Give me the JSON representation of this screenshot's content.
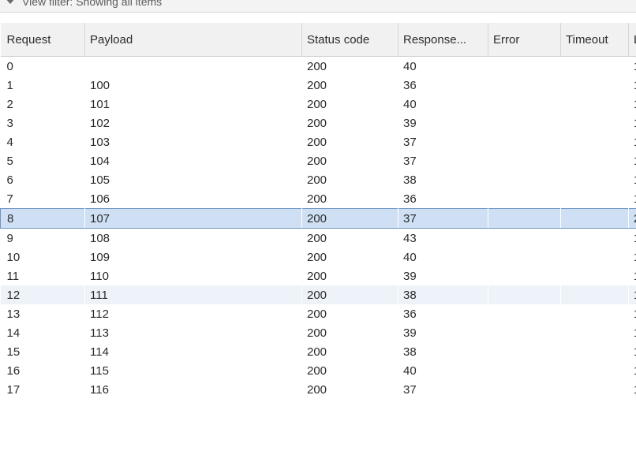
{
  "filter": {
    "label": "View filter: Showing all items"
  },
  "table": {
    "columns": [
      "Request",
      "Payload",
      "Status code",
      "Response...",
      "Error",
      "Timeout",
      "L"
    ],
    "rows": [
      {
        "request": "0",
        "payload": "",
        "status": "200",
        "response": "40",
        "error": "",
        "timeout": "",
        "length": "1"
      },
      {
        "request": "1",
        "payload": "100",
        "status": "200",
        "response": "36",
        "error": "",
        "timeout": "",
        "length": "1"
      },
      {
        "request": "2",
        "payload": "101",
        "status": "200",
        "response": "40",
        "error": "",
        "timeout": "",
        "length": "1"
      },
      {
        "request": "3",
        "payload": "102",
        "status": "200",
        "response": "39",
        "error": "",
        "timeout": "",
        "length": "1"
      },
      {
        "request": "4",
        "payload": "103",
        "status": "200",
        "response": "37",
        "error": "",
        "timeout": "",
        "length": "1"
      },
      {
        "request": "5",
        "payload": "104",
        "status": "200",
        "response": "37",
        "error": "",
        "timeout": "",
        "length": "1"
      },
      {
        "request": "6",
        "payload": "105",
        "status": "200",
        "response": "38",
        "error": "",
        "timeout": "",
        "length": "1"
      },
      {
        "request": "7",
        "payload": "106",
        "status": "200",
        "response": "36",
        "error": "",
        "timeout": "",
        "length": "1"
      },
      {
        "request": "8",
        "payload": "107",
        "status": "200",
        "response": "37",
        "error": "",
        "timeout": "",
        "length": "2"
      },
      {
        "request": "9",
        "payload": "108",
        "status": "200",
        "response": "43",
        "error": "",
        "timeout": "",
        "length": "1"
      },
      {
        "request": "10",
        "payload": "109",
        "status": "200",
        "response": "40",
        "error": "",
        "timeout": "",
        "length": "1"
      },
      {
        "request": "11",
        "payload": "110",
        "status": "200",
        "response": "39",
        "error": "",
        "timeout": "",
        "length": "1"
      },
      {
        "request": "12",
        "payload": "111",
        "status": "200",
        "response": "38",
        "error": "",
        "timeout": "",
        "length": "1"
      },
      {
        "request": "13",
        "payload": "112",
        "status": "200",
        "response": "36",
        "error": "",
        "timeout": "",
        "length": "1"
      },
      {
        "request": "14",
        "payload": "113",
        "status": "200",
        "response": "39",
        "error": "",
        "timeout": "",
        "length": "1"
      },
      {
        "request": "15",
        "payload": "114",
        "status": "200",
        "response": "38",
        "error": "",
        "timeout": "",
        "length": "1"
      },
      {
        "request": "16",
        "payload": "115",
        "status": "200",
        "response": "40",
        "error": "",
        "timeout": "",
        "length": "1"
      },
      {
        "request": "17",
        "payload": "116",
        "status": "200",
        "response": "37",
        "error": "",
        "timeout": "",
        "length": "1"
      }
    ],
    "selected_request": "8",
    "alternate_highlight_request": "12"
  }
}
